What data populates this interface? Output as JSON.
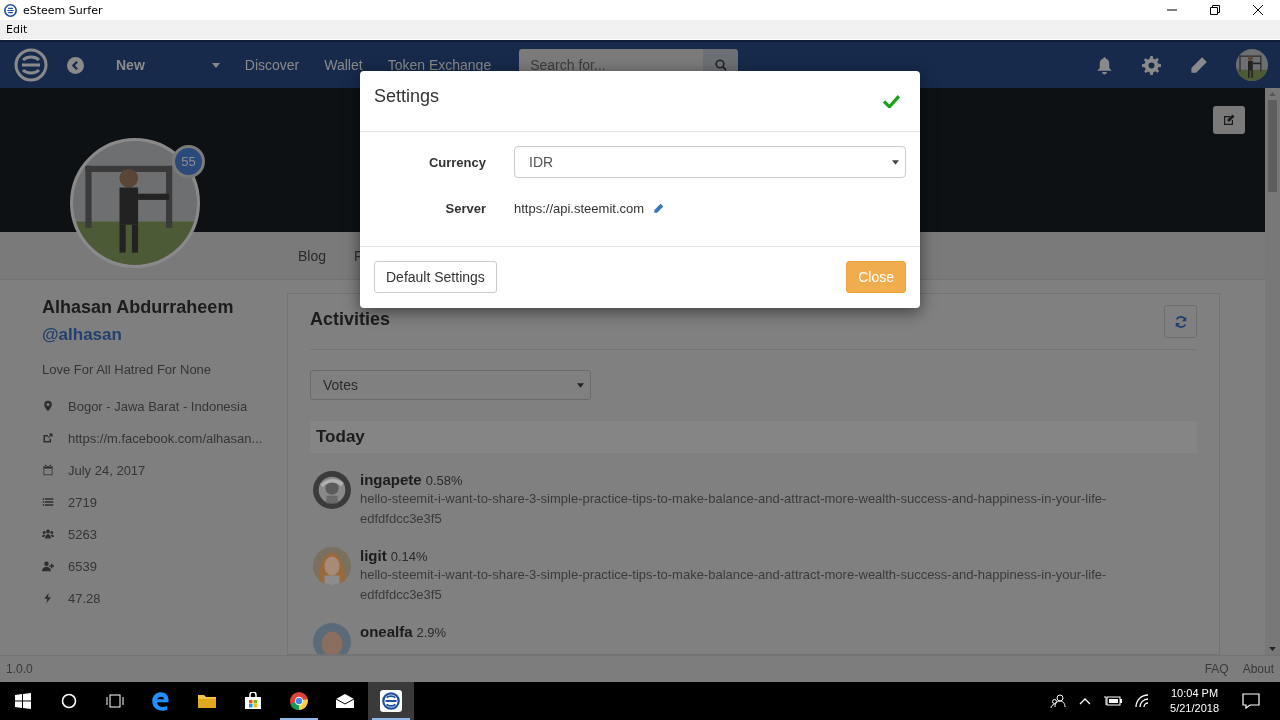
{
  "window": {
    "title": "eSteem Surfer"
  },
  "menu": [
    "Edit"
  ],
  "navbar": {
    "feed": "New",
    "links": [
      "Discover",
      "Wallet",
      "Token Exchange"
    ],
    "search": {
      "placeholder": "Search for..."
    }
  },
  "profile": {
    "name": "Alhasan Abdurraheem",
    "username": "@alhasan",
    "reputation": "55",
    "about": "Love For All Hatred For None",
    "details": [
      {
        "kind": "location",
        "text": "Bogor - Jawa Barat - Indonesia"
      },
      {
        "kind": "website",
        "text": "https://m.facebook.com/alhasan..."
      },
      {
        "kind": "joined",
        "text": "July 24, 2017"
      },
      {
        "kind": "posts",
        "text": "2719"
      },
      {
        "kind": "followers",
        "text": "5263"
      },
      {
        "kind": "following",
        "text": "6539"
      },
      {
        "kind": "power",
        "text": "47.28"
      }
    ]
  },
  "profile_tabs": [
    "Blog",
    "F"
  ],
  "activities": {
    "title": "Activities",
    "filter": "Votes",
    "groups": [
      {
        "label": "Today",
        "items": [
          {
            "user": "ingapete",
            "percent": "0.58%",
            "permlink": "hello-steemit-i-want-to-share-3-simple-practice-tips-to-make-balance-and-attract-more-wealth-success-and-happiness-in-your-life-edfdfdcc3e3f5"
          },
          {
            "user": "ligit",
            "percent": "0.14%",
            "permlink": "hello-steemit-i-want-to-share-3-simple-practice-tips-to-make-balance-and-attract-more-wealth-success-and-happiness-in-your-life-edfdfdcc3e3f5"
          },
          {
            "user": "onealfa",
            "percent": "2.9%"
          }
        ]
      }
    ]
  },
  "settings_dialog": {
    "title": "Settings",
    "fields": [
      {
        "label": "Currency",
        "kind": "select",
        "value": "IDR"
      },
      {
        "label": "Server",
        "kind": "text",
        "value": "https://api.steemit.com",
        "editable": true
      }
    ],
    "buttons": [
      {
        "label": "Default Settings",
        "kind": "default"
      },
      {
        "label": "Close",
        "kind": "primary"
      }
    ]
  },
  "footer": {
    "version": "1.0.0",
    "links": [
      "FAQ",
      "About"
    ]
  },
  "taskbar": {
    "apps": [
      {
        "kind": "start",
        "running": false,
        "selected": false
      },
      {
        "kind": "search",
        "running": false,
        "selected": false
      },
      {
        "kind": "taskview",
        "running": false,
        "selected": false
      },
      {
        "kind": "edge",
        "running": false,
        "selected": false
      },
      {
        "kind": "explorer",
        "running": false,
        "selected": false
      },
      {
        "kind": "store",
        "running": false,
        "selected": false
      },
      {
        "kind": "chrome",
        "running": true,
        "selected": false
      },
      {
        "kind": "mail",
        "running": false,
        "selected": false
      },
      {
        "kind": "esteem",
        "running": true,
        "selected": true
      }
    ],
    "time": "10:04 PM",
    "date": "5/21/2018"
  }
}
